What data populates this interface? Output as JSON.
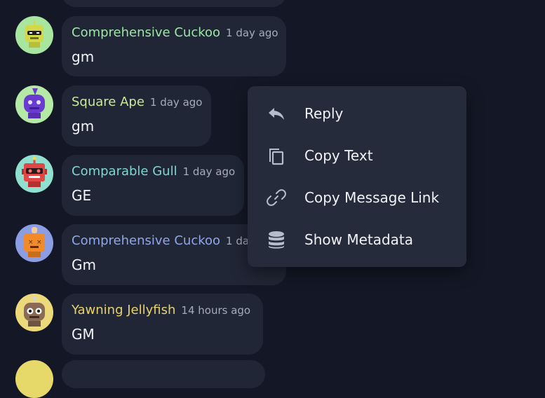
{
  "messages": [
    {
      "username": "Comprehensive Cuckoo",
      "time": "1 day ago",
      "text": "gm",
      "name_color": "#9be7a2",
      "avatar_bg": "#a8e6a0",
      "robot_color": "#d3d84a",
      "robot": "cuckoo-green-robot"
    },
    {
      "username": "Square Ape",
      "time": "1 day ago",
      "text": "gm",
      "name_color": "#c8e89a",
      "avatar_bg": "#b5e9a6",
      "robot_color": "#6a3bd1",
      "robot": "purple-robot"
    },
    {
      "username": "Comparable Gull",
      "time": "1 day ago",
      "text": "GE",
      "name_color": "#7fd6cf",
      "avatar_bg": "#8fe0cf",
      "robot_color": "#e04848",
      "robot": "red-robot"
    },
    {
      "username": "Comprehensive Cuckoo",
      "time": "1 da",
      "text": "Gm",
      "name_color": "#8fa7e6",
      "avatar_bg": "#8b9ee3",
      "robot_color": "#f08a2a",
      "robot": "orange-robot"
    },
    {
      "username": "Yawning Jellyfish",
      "time": "14 hours ago",
      "text": "GM",
      "name_color": "#e8d36a",
      "avatar_bg": "#ecd97a",
      "robot_color": "#8a6b55",
      "robot": "brown-robot"
    }
  ],
  "context_menu": {
    "items": [
      {
        "label": "Reply",
        "icon": "reply-icon"
      },
      {
        "label": "Copy Text",
        "icon": "copy-icon"
      },
      {
        "label": "Copy Message Link",
        "icon": "link-icon"
      },
      {
        "label": "Show Metadata",
        "icon": "database-icon"
      }
    ]
  },
  "colors": {
    "background": "#141826",
    "bubble": "#212636",
    "menu": "#262b3c",
    "icon": "#b7bccb"
  }
}
